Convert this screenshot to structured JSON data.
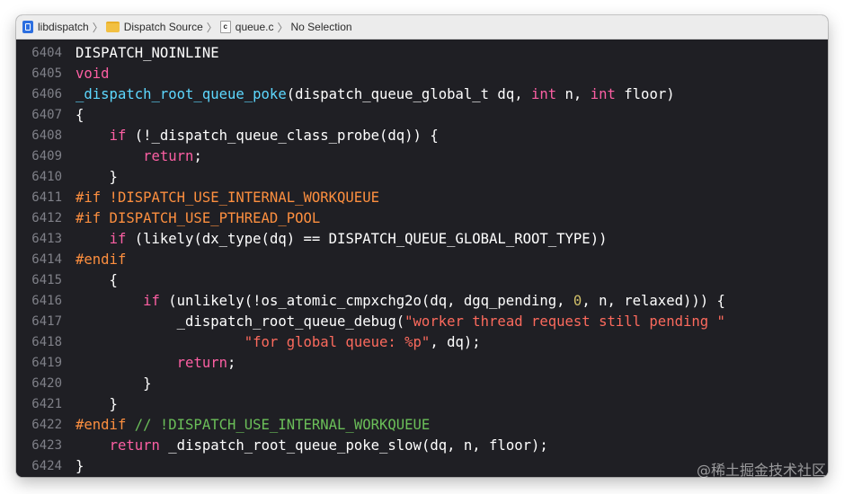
{
  "jumpbar": {
    "items": [
      {
        "label": "libdispatch",
        "icon": "project-icon"
      },
      {
        "label": "Dispatch Source",
        "icon": "folder-icon"
      },
      {
        "label": "queue.c",
        "icon": "c-file-icon",
        "icon_letter": "c"
      },
      {
        "label": "No Selection"
      }
    ]
  },
  "code": {
    "lines": [
      {
        "num": "6404",
        "tokens": [
          {
            "t": "DISPATCH_NOINLINE",
            "c": "pl"
          }
        ]
      },
      {
        "num": "6405",
        "tokens": [
          {
            "t": "void",
            "c": "kw"
          }
        ]
      },
      {
        "num": "6406",
        "tokens": [
          {
            "t": "_dispatch_root_queue_poke",
            "c": "fn"
          },
          {
            "t": "(dispatch_queue_global_t dq, ",
            "c": "pl"
          },
          {
            "t": "int",
            "c": "kw"
          },
          {
            "t": " n, ",
            "c": "pl"
          },
          {
            "t": "int",
            "c": "kw"
          },
          {
            "t": " floor)",
            "c": "pl"
          }
        ]
      },
      {
        "num": "6407",
        "tokens": [
          {
            "t": "{",
            "c": "pl"
          }
        ]
      },
      {
        "num": "6408",
        "tokens": [
          {
            "t": "    ",
            "c": "pl"
          },
          {
            "t": "if",
            "c": "kw"
          },
          {
            "t": " (!_dispatch_queue_class_probe(dq)) {",
            "c": "pl"
          }
        ]
      },
      {
        "num": "6409",
        "tokens": [
          {
            "t": "        ",
            "c": "pl"
          },
          {
            "t": "return",
            "c": "kw"
          },
          {
            "t": ";",
            "c": "pl"
          }
        ]
      },
      {
        "num": "6410",
        "tokens": [
          {
            "t": "    }",
            "c": "pl"
          }
        ]
      },
      {
        "num": "6411",
        "tokens": [
          {
            "t": "#if !DISPATCH_USE_INTERNAL_WORKQUEUE",
            "c": "pp"
          }
        ]
      },
      {
        "num": "6412",
        "tokens": [
          {
            "t": "#if DISPATCH_USE_PTHREAD_POOL",
            "c": "pp"
          }
        ]
      },
      {
        "num": "6413",
        "tokens": [
          {
            "t": "    ",
            "c": "pl"
          },
          {
            "t": "if",
            "c": "kw"
          },
          {
            "t": " (likely(dx_type(dq) == DISPATCH_QUEUE_GLOBAL_ROOT_TYPE))",
            "c": "pl"
          }
        ]
      },
      {
        "num": "6414",
        "tokens": [
          {
            "t": "#endif",
            "c": "pp"
          }
        ]
      },
      {
        "num": "6415",
        "tokens": [
          {
            "t": "    {",
            "c": "pl"
          }
        ]
      },
      {
        "num": "6416",
        "tokens": [
          {
            "t": "        ",
            "c": "pl"
          },
          {
            "t": "if",
            "c": "kw"
          },
          {
            "t": " (unlikely(!os_atomic_cmpxchg2o(dq, dgq_pending, ",
            "c": "pl"
          },
          {
            "t": "0",
            "c": "nm"
          },
          {
            "t": ", n, relaxed))) {",
            "c": "pl"
          }
        ]
      },
      {
        "num": "6417",
        "tokens": [
          {
            "t": "            _dispatch_root_queue_debug(",
            "c": "pl"
          },
          {
            "t": "\"worker thread request still pending \"",
            "c": "st"
          }
        ]
      },
      {
        "num": "6418",
        "tokens": [
          {
            "t": "                    ",
            "c": "pl"
          },
          {
            "t": "\"for global queue: %p\"",
            "c": "st"
          },
          {
            "t": ", dq);",
            "c": "pl"
          }
        ]
      },
      {
        "num": "6419",
        "tokens": [
          {
            "t": "            ",
            "c": "pl"
          },
          {
            "t": "return",
            "c": "kw"
          },
          {
            "t": ";",
            "c": "pl"
          }
        ]
      },
      {
        "num": "6420",
        "tokens": [
          {
            "t": "        }",
            "c": "pl"
          }
        ]
      },
      {
        "num": "6421",
        "tokens": [
          {
            "t": "    }",
            "c": "pl"
          }
        ]
      },
      {
        "num": "6422",
        "tokens": [
          {
            "t": "#endif ",
            "c": "pp"
          },
          {
            "t": "// !DISPATCH_USE_INTERNAL_WORKQUEUE",
            "c": "cm"
          }
        ]
      },
      {
        "num": "6423",
        "tokens": [
          {
            "t": "    ",
            "c": "pl"
          },
          {
            "t": "return",
            "c": "kw"
          },
          {
            "t": " _dispatch_root_queue_poke_slow(dq, n, floor);",
            "c": "pl"
          }
        ]
      },
      {
        "num": "6424",
        "tokens": [
          {
            "t": "}",
            "c": "pl"
          }
        ]
      }
    ]
  },
  "watermark": "@稀土掘金技术社区",
  "colors": {
    "background": "#1f1f24",
    "keyword": "#fc5fa3",
    "function": "#5dd8ff",
    "preprocessor": "#fd8f3f",
    "comment": "#6bbf59",
    "string": "#fc6a5d",
    "number": "#d0bf69",
    "line_number": "#7f8088"
  }
}
